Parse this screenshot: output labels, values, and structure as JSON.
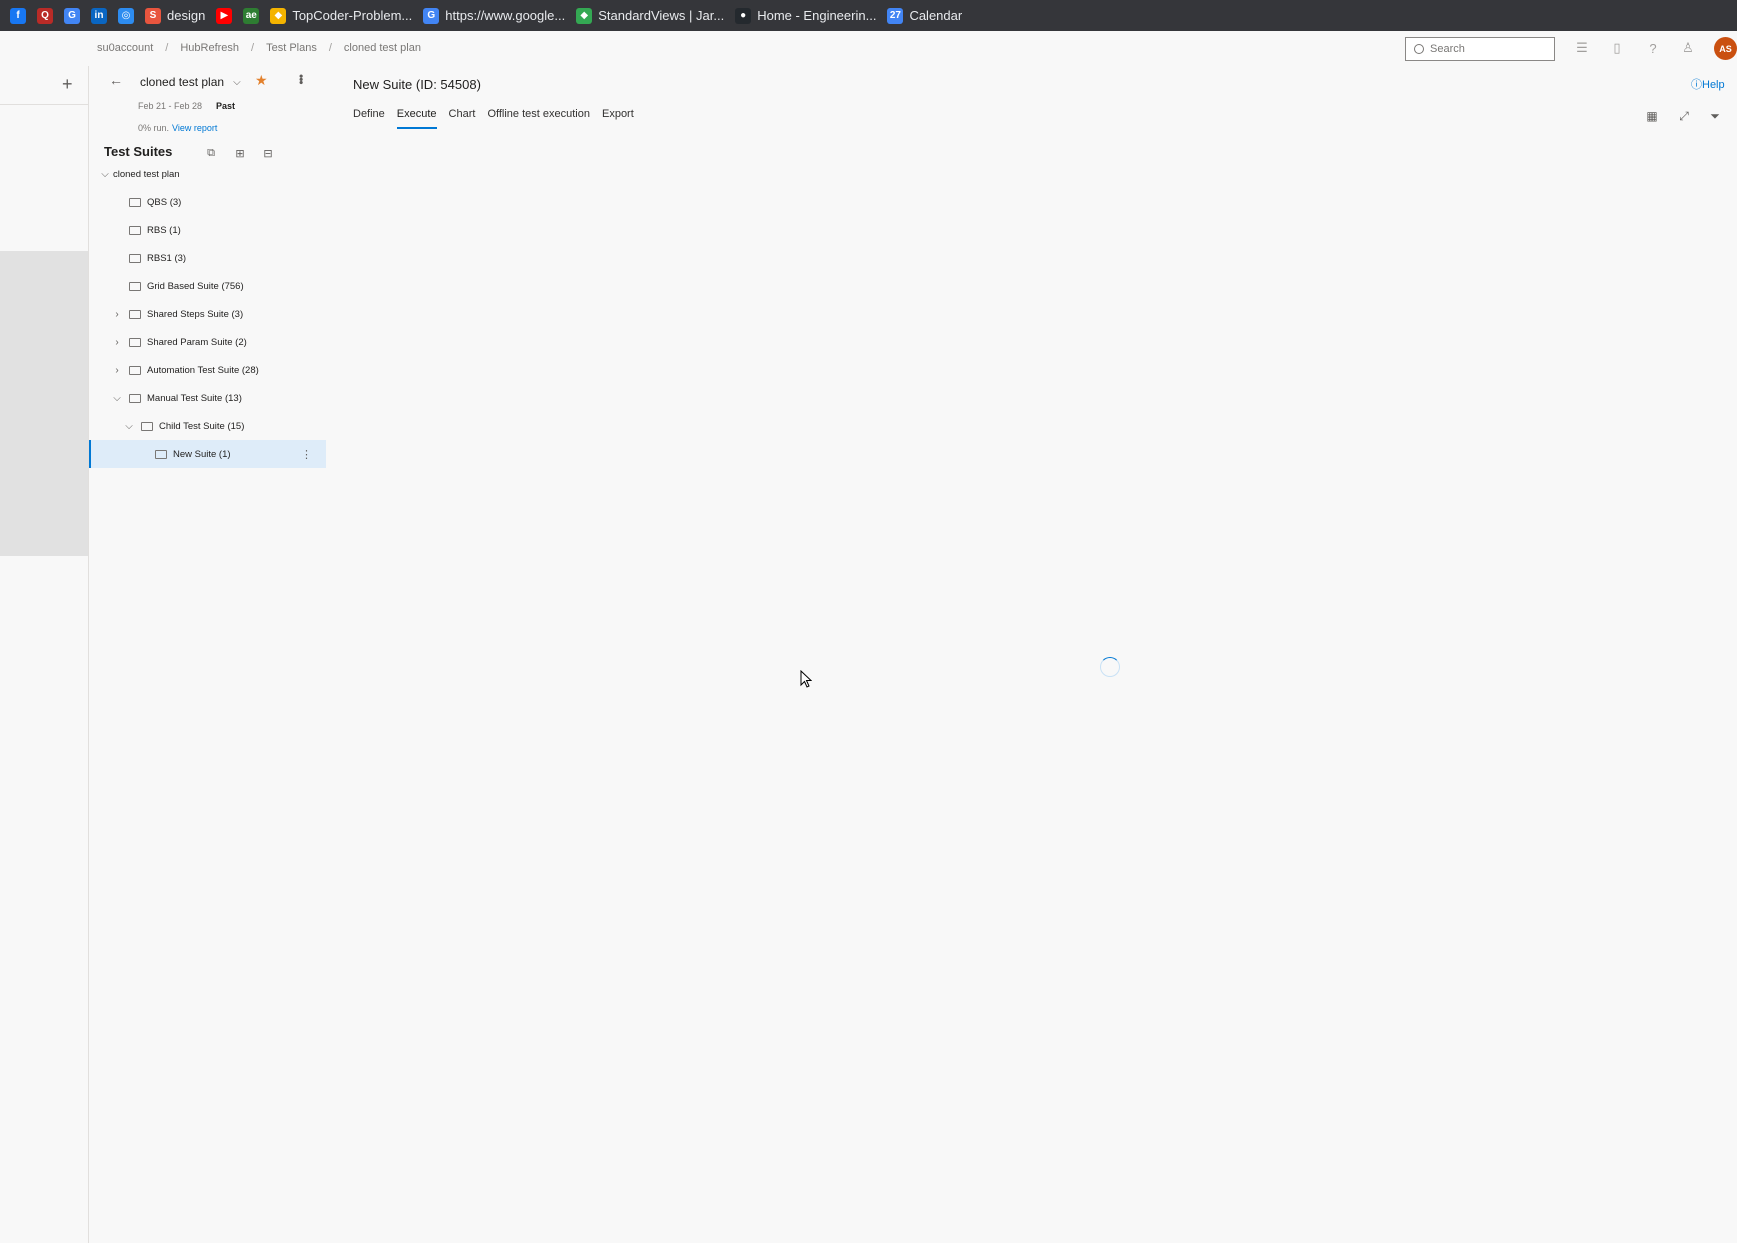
{
  "bookmarks": [
    {
      "label": "",
      "icon": "facebook-icon",
      "color": "#1877f2",
      "glyph": "f"
    },
    {
      "label": "",
      "icon": "quora-icon",
      "color": "#b92b27",
      "glyph": "Q"
    },
    {
      "label": "",
      "icon": "google-icon",
      "color": "#4285f4",
      "glyph": "G"
    },
    {
      "label": "",
      "icon": "linkedin-icon",
      "color": "#0a66c2",
      "glyph": "in"
    },
    {
      "label": "",
      "icon": "globe-icon",
      "color": "#2d8cf0",
      "glyph": "◎"
    },
    {
      "label": "design",
      "icon": "design-icon",
      "color": "#e8553e",
      "glyph": "S"
    },
    {
      "label": "",
      "icon": "youtube-icon",
      "color": "#ff0000",
      "glyph": "▶"
    },
    {
      "label": "",
      "icon": "ae-icon",
      "color": "#2e7d32",
      "glyph": "ae"
    },
    {
      "label": "TopCoder-Problem...",
      "icon": "topcoder-icon",
      "color": "#f4b400",
      "glyph": "◆"
    },
    {
      "label": "https://www.google...",
      "icon": "google-icon",
      "color": "#4285f4",
      "glyph": "G"
    },
    {
      "label": "StandardViews | Jar...",
      "icon": "standardviews-icon",
      "color": "#34a853",
      "glyph": "◆"
    },
    {
      "label": "Home - Engineerin...",
      "icon": "github-icon",
      "color": "#24292e",
      "glyph": "●"
    },
    {
      "label": "Calendar",
      "icon": "calendar-icon",
      "color": "#4285f4",
      "glyph": "27"
    }
  ],
  "breadcrumb": [
    "su0account",
    "HubRefresh",
    "Test Plans",
    "cloned test plan"
  ],
  "search": {
    "placeholder": "Search"
  },
  "avatar": {
    "initials": "AS"
  },
  "plan": {
    "title": "cloned test plan",
    "dates": "Feb 21 - Feb 28",
    "status": "Past",
    "run_text": "0% run.",
    "report_link": "View report"
  },
  "test_suites": {
    "title": "Test Suites",
    "items": [
      {
        "label": "cloned test plan",
        "level": 0,
        "toggle": "down",
        "folder": false
      },
      {
        "label": "QBS (3)",
        "level": 1,
        "toggle": "",
        "folder": true
      },
      {
        "label": "RBS (1)",
        "level": 1,
        "toggle": "",
        "folder": true
      },
      {
        "label": "RBS1 (3)",
        "level": 1,
        "toggle": "",
        "folder": true
      },
      {
        "label": "Grid Based Suite (756)",
        "level": 1,
        "toggle": "",
        "folder": true
      },
      {
        "label": "Shared Steps Suite (3)",
        "level": 1,
        "toggle": "right",
        "folder": true
      },
      {
        "label": "Shared Param Suite (2)",
        "level": 1,
        "toggle": "right",
        "folder": true
      },
      {
        "label": "Automation Test Suite (28)",
        "level": 1,
        "toggle": "right",
        "folder": true
      },
      {
        "label": "Manual Test Suite (13)",
        "level": 1,
        "toggle": "down",
        "folder": true
      },
      {
        "label": "Child Test Suite (15)",
        "level": 2,
        "toggle": "down",
        "folder": true
      },
      {
        "label": "New Suite (1)",
        "level": 3,
        "toggle": "",
        "folder": true,
        "selected": true
      }
    ]
  },
  "main": {
    "suite_title": "New Suite (ID: 54508)",
    "help": "Help",
    "tabs": [
      {
        "label": "Define",
        "active": false
      },
      {
        "label": "Execute",
        "active": true
      },
      {
        "label": "Chart",
        "active": false
      },
      {
        "label": "Offline test execution",
        "active": false
      },
      {
        "label": "Export",
        "active": false
      }
    ]
  },
  "colors": {
    "accent": "#0078d4",
    "avatar": "#ca5010",
    "star": "#e3812d",
    "selected_bg": "#deecf9"
  }
}
